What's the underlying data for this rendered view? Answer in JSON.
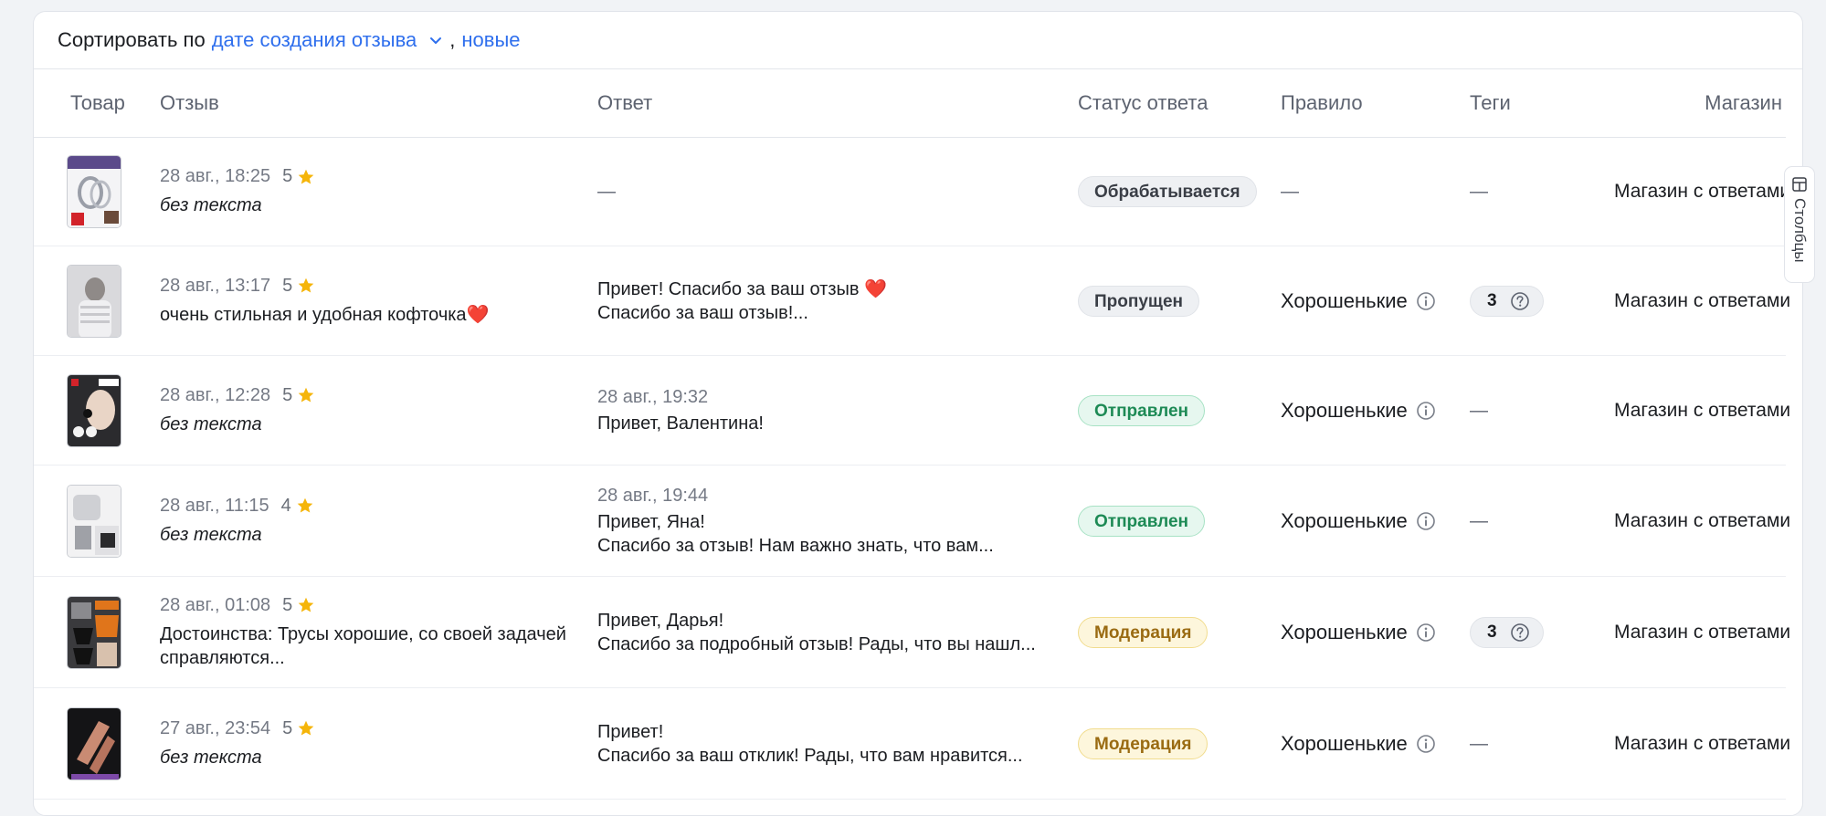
{
  "sort": {
    "label": "Сортировать по",
    "field": "дате создания отзыва",
    "comma": ",",
    "order": "новые"
  },
  "columns": {
    "product": "Товар",
    "review": "Отзыв",
    "answer": "Ответ",
    "status": "Статус ответа",
    "rule": "Правило",
    "tags": "Теги",
    "shop": "Магазин"
  },
  "columns_button": {
    "label": "Столбцы",
    "icon": "columns-icon"
  },
  "colors": {
    "accent": "#2f6fed",
    "star": "#f5b50a",
    "status_green": "#1d8a55",
    "status_yellow": "#9a6b12"
  },
  "rows": [
    {
      "date": "28 авг., 18:25",
      "rating": "5",
      "text": "без текста",
      "answer_time": "",
      "answer_line1": "—",
      "answer_line2": "",
      "status": "Обрабатывается",
      "rule": "—",
      "tags": "—",
      "shop": "Магазин с ответами"
    },
    {
      "date": "28 авг., 13:17",
      "rating": "5",
      "text": "очень стильная и удобная кофточка❤️",
      "answer_time": "",
      "answer_line1": "Привет! Спасибо за ваш отзыв ❤️",
      "answer_line2": "Спасибо за ваш отзыв!...",
      "status": "Пропущен",
      "rule": "Хорошенькие",
      "tags": "3",
      "shop": "Магазин с ответами"
    },
    {
      "date": "28 авг., 12:28",
      "rating": "5",
      "text": "без текста",
      "answer_time": "28 авг., 19:32",
      "answer_line1": "Привет, Валентина!",
      "answer_line2": "",
      "status": "Отправлен",
      "rule": "Хорошенькие",
      "tags": "—",
      "shop": "Магазин с ответами"
    },
    {
      "date": "28 авг., 11:15",
      "rating": "4",
      "text": "без текста",
      "answer_time": "28 авг., 19:44",
      "answer_line1": "Привет, Яна!",
      "answer_line2": "Спасибо за отзыв! Нам важно знать, что вам...",
      "status": "Отправлен",
      "rule": "Хорошенькие",
      "tags": "—",
      "shop": "Магазин с ответами"
    },
    {
      "date": "28 авг., 01:08",
      "rating": "5",
      "text": "Достоинства: Трусы хорошие, со своей задачей справляются...",
      "answer_time": "",
      "answer_line1": "Привет, Дарья!",
      "answer_line2": "Спасибо за подробный отзыв! Рады, что вы нашл...",
      "status": "Модерация",
      "rule": "Хорошенькие",
      "tags": "3",
      "shop": "Магазин с ответами"
    },
    {
      "date": "27 авг., 23:54",
      "rating": "5",
      "text": "без текста",
      "answer_time": "",
      "answer_line1": "Привет!",
      "answer_line2": "Спасибо за ваш отклик! Рады, что вам нравится...",
      "status": "Модерация",
      "rule": "Хорошенькие",
      "tags": "—",
      "shop": "Магазин с ответами"
    }
  ]
}
